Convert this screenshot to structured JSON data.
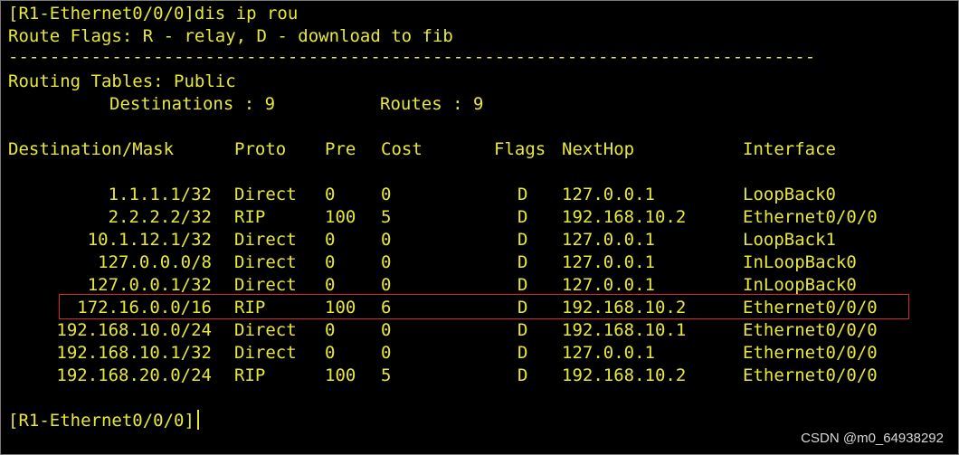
{
  "terminal": {
    "command_line": "[R1-Ethernet0/0/0]dis ip rou",
    "flags_line": "Route Flags: R - relay, D - download to fib",
    "divider": "------------------------------------------------------------------------------",
    "tables_line": "Routing Tables: Public",
    "destinations_label": "Destinations : 9",
    "routes_label": "Routes : 9",
    "prompt": "[R1-Ethernet0/0/0]",
    "columns": {
      "dest": "Destination/Mask",
      "proto": "Proto",
      "pre": "Pre",
      "cost": "Cost",
      "flags": "Flags",
      "nexthop": "NextHop",
      "iface": "Interface"
    },
    "rows": [
      {
        "dest": "1.1.1.1/32",
        "proto": "Direct",
        "pre": "0",
        "cost": "0",
        "flags": "D",
        "nexthop": "127.0.0.1",
        "iface": "LoopBack0"
      },
      {
        "dest": "2.2.2.2/32",
        "proto": "RIP",
        "pre": "100",
        "cost": "5",
        "flags": "D",
        "nexthop": "192.168.10.2",
        "iface": "Ethernet0/0/0"
      },
      {
        "dest": "10.1.12.1/32",
        "proto": "Direct",
        "pre": "0",
        "cost": "0",
        "flags": "D",
        "nexthop": "127.0.0.1",
        "iface": "LoopBack1"
      },
      {
        "dest": "127.0.0.0/8",
        "proto": "Direct",
        "pre": "0",
        "cost": "0",
        "flags": "D",
        "nexthop": "127.0.0.1",
        "iface": "InLoopBack0"
      },
      {
        "dest": "127.0.0.1/32",
        "proto": "Direct",
        "pre": "0",
        "cost": "0",
        "flags": "D",
        "nexthop": "127.0.0.1",
        "iface": "InLoopBack0"
      },
      {
        "dest": "172.16.0.0/16",
        "proto": "RIP",
        "pre": "100",
        "cost": "6",
        "flags": "D",
        "nexthop": "192.168.10.2",
        "iface": "Ethernet0/0/0"
      },
      {
        "dest": "192.168.10.0/24",
        "proto": "Direct",
        "pre": "0",
        "cost": "0",
        "flags": "D",
        "nexthop": "192.168.10.1",
        "iface": "Ethernet0/0/0"
      },
      {
        "dest": "192.168.10.1/32",
        "proto": "Direct",
        "pre": "0",
        "cost": "0",
        "flags": "D",
        "nexthop": "127.0.0.1",
        "iface": "Ethernet0/0/0"
      },
      {
        "dest": "192.168.20.0/24",
        "proto": "RIP",
        "pre": "100",
        "cost": "5",
        "flags": "D",
        "nexthop": "192.168.10.2",
        "iface": "Ethernet0/0/0"
      }
    ]
  },
  "watermark": "CSDN @m0_64938292",
  "colors": {
    "background": "#000000",
    "text": "#e8e83a",
    "highlight": "#d9252c"
  }
}
